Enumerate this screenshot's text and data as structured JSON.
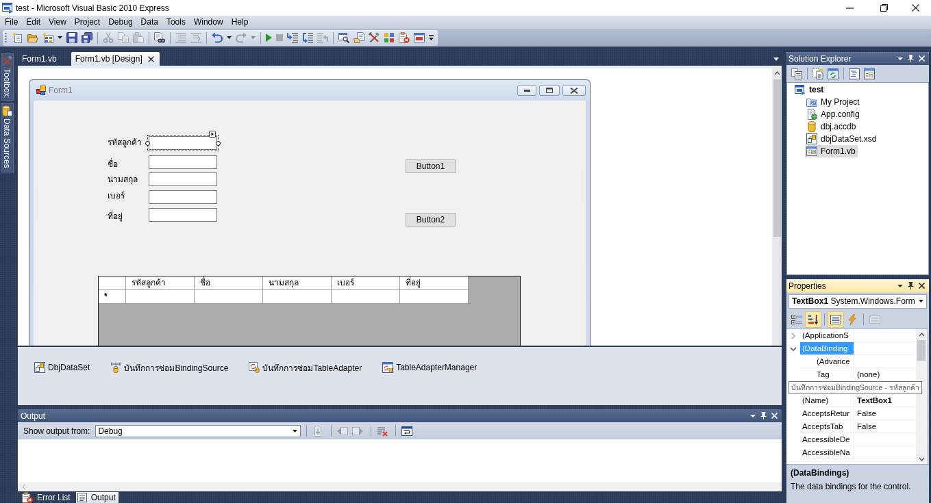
{
  "window": {
    "title": "test - Microsoft Visual Basic 2010 Express"
  },
  "menu": [
    "File",
    "Edit",
    "View",
    "Project",
    "Debug",
    "Data",
    "Tools",
    "Window",
    "Help"
  ],
  "toolbar": [
    {
      "kind": "new",
      "disabled": false
    },
    {
      "kind": "open",
      "disabled": false
    },
    {
      "kind": "additem",
      "disabled": false
    },
    {
      "kind": "caret",
      "disabled": false
    },
    {
      "kind": "save",
      "disabled": false
    },
    {
      "kind": "saveall",
      "disabled": false
    },
    {
      "kind": "separator"
    },
    {
      "kind": "cut",
      "disabled": true
    },
    {
      "kind": "copy",
      "disabled": true
    },
    {
      "kind": "paste",
      "disabled": true
    },
    {
      "kind": "separator"
    },
    {
      "kind": "find",
      "disabled": false
    },
    {
      "kind": "separator"
    },
    {
      "kind": "comment",
      "disabled": true
    },
    {
      "kind": "uncomment",
      "disabled": true
    },
    {
      "kind": "separator"
    },
    {
      "kind": "undo",
      "disabled": false
    },
    {
      "kind": "caret",
      "disabled": false
    },
    {
      "kind": "redo",
      "disabled": true
    },
    {
      "kind": "caret",
      "disabled": true
    },
    {
      "kind": "separator"
    },
    {
      "kind": "start",
      "disabled": false
    },
    {
      "kind": "stop",
      "disabled": true
    },
    {
      "kind": "stepinto",
      "disabled": false
    },
    {
      "kind": "stepover",
      "disabled": false
    },
    {
      "kind": "stepout",
      "disabled": true
    },
    {
      "kind": "separator"
    },
    {
      "kind": "findwindow",
      "disabled": false
    },
    {
      "kind": "propertywindow",
      "disabled": false
    },
    {
      "kind": "toolbox",
      "disabled": false
    },
    {
      "kind": "objects",
      "disabled": false
    },
    {
      "kind": "errors",
      "disabled": false
    },
    {
      "kind": "startpage",
      "disabled": false
    },
    {
      "kind": "overflow",
      "disabled": false
    }
  ],
  "side_tabs": [
    {
      "label": "Toolbox",
      "kind": "toolbox"
    },
    {
      "label": "Data Sources",
      "kind": "datasources"
    }
  ],
  "document_tabs": [
    {
      "label": "Form1.vb",
      "selected": false
    },
    {
      "label": "Form1.vb [Design]",
      "selected": true
    }
  ],
  "form": {
    "title": "Form1",
    "fields": [
      {
        "label": "รหัสลูกค้า",
        "selected": true
      },
      {
        "label": "ชื่อ",
        "selected": false
      },
      {
        "label": "นามสกุล",
        "selected": false
      },
      {
        "label": "เบอร์",
        "selected": false
      },
      {
        "label": "ที่อยู่",
        "selected": false
      }
    ],
    "buttons": [
      "Button1",
      "Button2"
    ],
    "grid": {
      "columns": [
        "รหัสลูกค้า",
        "ชื่อ",
        "นามสกุล",
        "เบอร์",
        "ที่อยู่"
      ],
      "new_row_marker": "*"
    }
  },
  "component_tray": [
    {
      "label": "DbjDataSet",
      "kind": "dataset"
    },
    {
      "label": "บันทึกการซ่อมBindingSource",
      "kind": "bindingsource"
    },
    {
      "label": "บันทึกการซ่อมTableAdapter",
      "kind": "tableadapter"
    },
    {
      "label": "TableAdapterManager",
      "kind": "manager"
    }
  ],
  "output": {
    "title": "Output",
    "source_label": "Show output from:",
    "source": "Debug",
    "toolbar": [
      {
        "kind": "separator"
      },
      {
        "kind": "gotocode",
        "disabled": true
      },
      {
        "kind": "separator"
      },
      {
        "kind": "previous",
        "disabled": true
      },
      {
        "kind": "next",
        "disabled": true
      },
      {
        "kind": "separator"
      },
      {
        "kind": "clear",
        "disabled": false
      },
      {
        "kind": "separator"
      },
      {
        "kind": "wrap",
        "disabled": false
      }
    ]
  },
  "bottom_tabs": [
    {
      "label": "Error List",
      "kind": "errors",
      "selected": false
    },
    {
      "label": "Output",
      "kind": "output",
      "selected": true
    }
  ],
  "solution_explorer": {
    "title": "Solution Explorer",
    "tree": [
      {
        "label": "test",
        "kind": "project",
        "selected": false,
        "children": [
          {
            "label": "My Project",
            "kind": "myproject",
            "selected": false
          },
          {
            "label": "App.config",
            "kind": "config",
            "selected": false
          },
          {
            "label": "dbj.accdb",
            "kind": "database",
            "selected": false
          },
          {
            "label": "dbjDataSet.xsd",
            "kind": "dataset",
            "selected": false
          },
          {
            "label": "Form1.vb",
            "kind": "form",
            "selected": true
          }
        ]
      }
    ]
  },
  "properties": {
    "title": "Properties",
    "object_name": "TextBox1",
    "object_type": "System.Windows.Form",
    "toolbar": [
      {
        "kind": "categorized",
        "selected": false,
        "disabled": false
      },
      {
        "kind": "alphabetical",
        "selected": true,
        "disabled": false
      },
      {
        "kind": "separator"
      },
      {
        "kind": "proplist",
        "selected": true,
        "disabled": false
      },
      {
        "kind": "events",
        "selected": false,
        "disabled": false
      },
      {
        "kind": "separator"
      },
      {
        "kind": "pages",
        "selected": false,
        "disabled": true
      }
    ],
    "rows": [
      {
        "kind": "group",
        "name": "(ApplicationS",
        "expanded": false,
        "selected": false
      },
      {
        "kind": "group",
        "name": "(DataBinding",
        "expanded": true,
        "selected": true,
        "children": [
          {
            "kind": "property",
            "name": "(Advance",
            "selected": false
          },
          {
            "kind": "property",
            "name": "Tag",
            "value": "(none)",
            "modified": false,
            "selected": false
          },
          {
            "kind": "tooltip",
            "text": "บันทึกการซ่อมBindingSource - รหัสลูกค้า"
          }
        ]
      },
      {
        "kind": "property",
        "name": "(Name)",
        "value": "TextBox1",
        "modified": true,
        "selected": false
      },
      {
        "kind": "property",
        "name": "AcceptsRetur",
        "value": "False",
        "modified": false,
        "selected": false
      },
      {
        "kind": "property",
        "name": "AcceptsTab",
        "value": "False",
        "modified": false,
        "selected": false
      },
      {
        "kind": "property",
        "name": "AccessibleDe",
        "selected": false
      },
      {
        "kind": "property",
        "name": "AccessibleNa",
        "selected": false
      }
    ],
    "description": {
      "title": "(DataBindings)",
      "text": "The data bindings for the control."
    }
  }
}
